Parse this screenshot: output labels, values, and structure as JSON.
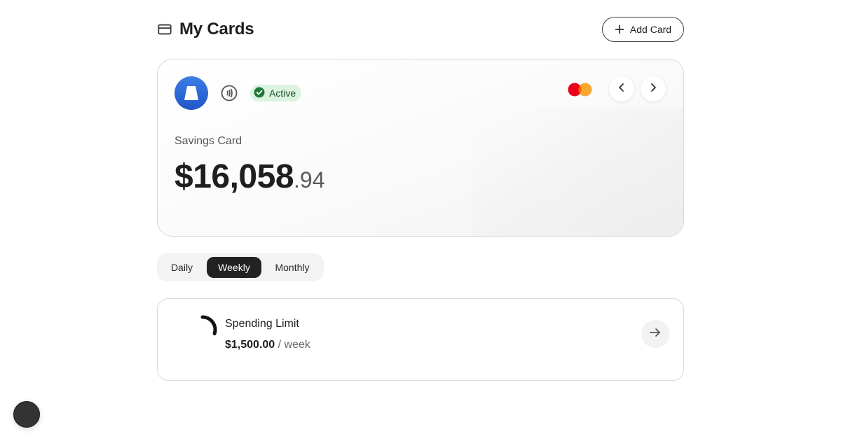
{
  "header": {
    "title": "My Cards",
    "title_icon": "credit-card-icon",
    "add_button_label": "Add Card",
    "add_button_icon": "plus-icon"
  },
  "card": {
    "bank_logo_icon": "bank-logo-icon",
    "contactless_icon": "contactless-icon",
    "status": "Active",
    "status_icon": "check-circle-icon",
    "network_icon": "mastercard-icon",
    "card_name": "Savings Card",
    "balance_main": "$16,058",
    "balance_cents": ".94",
    "prev_icon": "chevron-left-icon",
    "next_icon": "chevron-right-icon",
    "colors": {
      "logo": "#2b6adb",
      "status_bg": "#dcf3df",
      "status_check": "#1e7a36",
      "mastercard_red": "#eb001b",
      "mastercard_orange": "#f79e1b"
    }
  },
  "period_tabs": {
    "items": [
      "Daily",
      "Weekly",
      "Monthly"
    ],
    "selected": "Weekly"
  },
  "spending_limit": {
    "title": "Spending Limit",
    "amount": "$1,500.00",
    "period": " / week",
    "progress_fraction": 0.3,
    "arrow_icon": "arrow-right-icon"
  },
  "floating_button": {
    "icon": "avatar-icon"
  }
}
